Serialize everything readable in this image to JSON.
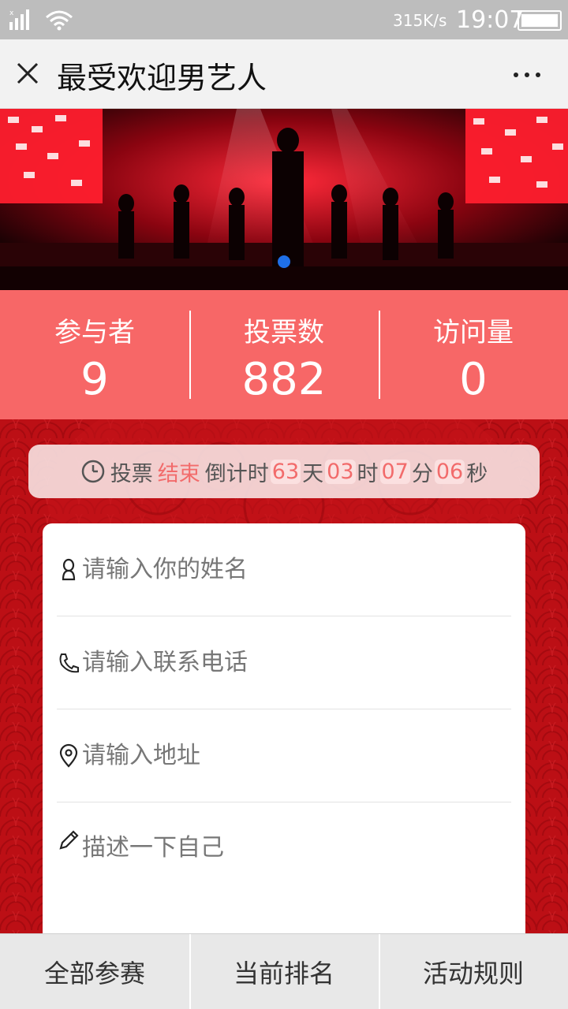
{
  "status_bar": {
    "net_speed": "315K/s",
    "time": "19:07"
  },
  "nav": {
    "title": "最受欢迎男艺人"
  },
  "stats": [
    {
      "label": "参与者",
      "value": "9"
    },
    {
      "label": "投票数",
      "value": "882"
    },
    {
      "label": "访问量",
      "value": "0"
    }
  ],
  "countdown": {
    "prefix": "投票",
    "state": "结束",
    "countdown_label": "倒计时",
    "days": "63",
    "days_unit": "天",
    "hours": "03",
    "hours_unit": "时",
    "minutes": "07",
    "minutes_unit": "分",
    "seconds": "06",
    "seconds_unit": "秒"
  },
  "form": {
    "name_placeholder": "请输入你的姓名",
    "phone_placeholder": "请输入联系电话",
    "address_placeholder": "请输入地址",
    "description_placeholder": "描述一下自己"
  },
  "tabs": [
    {
      "label": "全部参赛"
    },
    {
      "label": "当前排名"
    },
    {
      "label": "活动规则"
    }
  ],
  "colors": {
    "stats_bg": "#f76767",
    "accent": "#f26b6b",
    "page_bg": "#b80d12",
    "dot": "#1f6fe8"
  }
}
